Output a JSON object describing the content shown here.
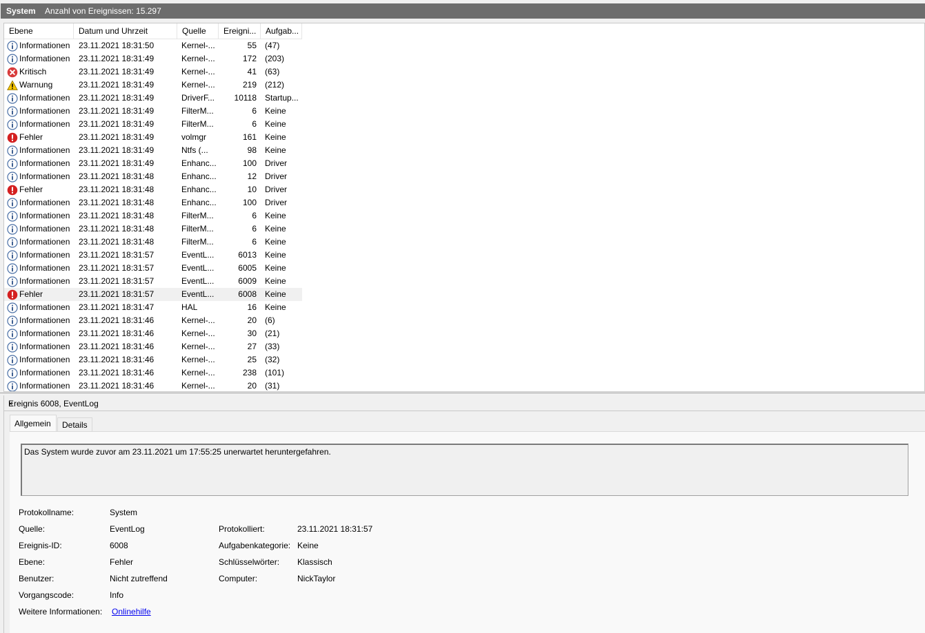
{
  "window": {
    "log_name": "System",
    "event_count": "Anzahl von Ereignissen: 15.297"
  },
  "columns": [
    "Ebene",
    "Datum und Uhrzeit",
    "Quelle",
    "Ereigni...",
    "Aufgab..."
  ],
  "rows": [
    {
      "level": "Informationen",
      "icon": "info-icon",
      "date": "23.11.2021 18:31:50",
      "source": "Kernel-...",
      "id": "55",
      "task": "(47)"
    },
    {
      "level": "Informationen",
      "icon": "info-icon",
      "date": "23.11.2021 18:31:49",
      "source": "Kernel-...",
      "id": "172",
      "task": "(203)"
    },
    {
      "level": "Kritisch",
      "icon": "critical-icon",
      "date": "23.11.2021 18:31:49",
      "source": "Kernel-...",
      "id": "41",
      "task": "(63)"
    },
    {
      "level": "Warnung",
      "icon": "warning-icon",
      "date": "23.11.2021 18:31:49",
      "source": "Kernel-...",
      "id": "219",
      "task": "(212)"
    },
    {
      "level": "Informationen",
      "icon": "info-icon",
      "date": "23.11.2021 18:31:49",
      "source": "DriverF...",
      "id": "10118",
      "task": "Startup..."
    },
    {
      "level": "Informationen",
      "icon": "info-icon",
      "date": "23.11.2021 18:31:49",
      "source": "FilterM...",
      "id": "6",
      "task": "Keine"
    },
    {
      "level": "Informationen",
      "icon": "info-icon",
      "date": "23.11.2021 18:31:49",
      "source": "FilterM...",
      "id": "6",
      "task": "Keine"
    },
    {
      "level": "Fehler",
      "icon": "error-icon",
      "date": "23.11.2021 18:31:49",
      "source": "volmgr",
      "id": "161",
      "task": "Keine"
    },
    {
      "level": "Informationen",
      "icon": "info-icon",
      "date": "23.11.2021 18:31:49",
      "source": "Ntfs (...",
      "id": "98",
      "task": "Keine"
    },
    {
      "level": "Informationen",
      "icon": "info-icon",
      "date": "23.11.2021 18:31:49",
      "source": "Enhanc...",
      "id": "100",
      "task": "Driver"
    },
    {
      "level": "Informationen",
      "icon": "info-icon",
      "date": "23.11.2021 18:31:48",
      "source": "Enhanc...",
      "id": "12",
      "task": "Driver"
    },
    {
      "level": "Fehler",
      "icon": "error-icon",
      "date": "23.11.2021 18:31:48",
      "source": "Enhanc...",
      "id": "10",
      "task": "Driver"
    },
    {
      "level": "Informationen",
      "icon": "info-icon",
      "date": "23.11.2021 18:31:48",
      "source": "Enhanc...",
      "id": "100",
      "task": "Driver"
    },
    {
      "level": "Informationen",
      "icon": "info-icon",
      "date": "23.11.2021 18:31:48",
      "source": "FilterM...",
      "id": "6",
      "task": "Keine"
    },
    {
      "level": "Informationen",
      "icon": "info-icon",
      "date": "23.11.2021 18:31:48",
      "source": "FilterM...",
      "id": "6",
      "task": "Keine"
    },
    {
      "level": "Informationen",
      "icon": "info-icon",
      "date": "23.11.2021 18:31:48",
      "source": "FilterM...",
      "id": "6",
      "task": "Keine"
    },
    {
      "level": "Informationen",
      "icon": "info-icon",
      "date": "23.11.2021 18:31:57",
      "source": "EventL...",
      "id": "6013",
      "task": "Keine"
    },
    {
      "level": "Informationen",
      "icon": "info-icon",
      "date": "23.11.2021 18:31:57",
      "source": "EventL...",
      "id": "6005",
      "task": "Keine"
    },
    {
      "level": "Informationen",
      "icon": "info-icon",
      "date": "23.11.2021 18:31:57",
      "source": "EventL...",
      "id": "6009",
      "task": "Keine"
    },
    {
      "level": "Fehler",
      "icon": "error-icon",
      "date": "23.11.2021 18:31:57",
      "source": "EventL...",
      "id": "6008",
      "task": "Keine",
      "selected": true
    },
    {
      "level": "Informationen",
      "icon": "info-icon",
      "date": "23.11.2021 18:31:47",
      "source": "HAL",
      "id": "16",
      "task": "Keine"
    },
    {
      "level": "Informationen",
      "icon": "info-icon",
      "date": "23.11.2021 18:31:46",
      "source": "Kernel-...",
      "id": "20",
      "task": "(6)"
    },
    {
      "level": "Informationen",
      "icon": "info-icon",
      "date": "23.11.2021 18:31:46",
      "source": "Kernel-...",
      "id": "30",
      "task": "(21)"
    },
    {
      "level": "Informationen",
      "icon": "info-icon",
      "date": "23.11.2021 18:31:46",
      "source": "Kernel-...",
      "id": "27",
      "task": "(33)"
    },
    {
      "level": "Informationen",
      "icon": "info-icon",
      "date": "23.11.2021 18:31:46",
      "source": "Kernel-...",
      "id": "25",
      "task": "(32)"
    },
    {
      "level": "Informationen",
      "icon": "info-icon",
      "date": "23.11.2021 18:31:46",
      "source": "Kernel-...",
      "id": "238",
      "task": "(101)"
    },
    {
      "level": "Informationen",
      "icon": "info-icon",
      "date": "23.11.2021 18:31:46",
      "source": "Kernel-...",
      "id": "20",
      "task": "(31)"
    }
  ],
  "detail": {
    "title": "Ereignis 6008, EventLog",
    "close": "×",
    "tabs": {
      "general": "Allgemein",
      "details": "Details"
    },
    "message": "Das System wurde zuvor am 23.11.2021 um 17:55:25 unerwartet heruntergefahren.",
    "labels": {
      "log_name": "Protokollname:",
      "source": "Quelle:",
      "event_id": "Ereignis-ID:",
      "level": "Ebene:",
      "user": "Benutzer:",
      "opcode": "Vorgangscode:",
      "more_info": "Weitere Informationen:",
      "logged": "Protokolliert:",
      "task_category": "Aufgabenkategorie:",
      "keywords": "Schlüsselwörter:",
      "computer": "Computer:"
    },
    "values": {
      "log_name": "System",
      "source": "EventLog",
      "event_id": "6008",
      "level": "Fehler",
      "user": "Nicht zutreffend",
      "opcode": "Info",
      "more_info": "Onlinehilfe",
      "logged": "23.11.2021 18:31:57",
      "task_category": "Keine",
      "keywords": "Klassisch",
      "computer": "NickTaylor"
    }
  }
}
